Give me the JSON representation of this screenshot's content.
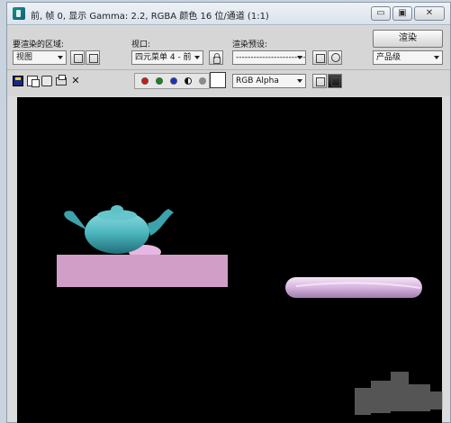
{
  "window": {
    "title": "前, 帧 0, 显示 Gamma: 2.2, RGBA 颜色 16 位/通道 (1:1)",
    "controls": [
      "minimize-icon",
      "maximize-icon",
      "close-icon"
    ]
  },
  "render_area": {
    "label": "要渲染的区域:",
    "value": "视图"
  },
  "viewport_select": {
    "label": "视口:",
    "value": "四元菜单 4 - 前"
  },
  "render_preset": {
    "label": "渲染预设:",
    "value": "-------------------------"
  },
  "render_button": {
    "label": "渲染"
  },
  "quality": {
    "value": "产品级"
  },
  "toolbar": {
    "icons": [
      "save-image-icon",
      "copy-image-icon",
      "clone-window-icon",
      "print-icon",
      "clear-icon"
    ],
    "clear_glyph": "✕"
  },
  "channels": {
    "colors": {
      "red": "#d01818",
      "green": "#0e8a1e",
      "blue": "#1a2fc0",
      "mono": "#111111",
      "gray": "#8a8a8a"
    }
  },
  "display_channel": {
    "value": "RGB Alpha"
  },
  "colors": {
    "teapot": "#4fb7bf",
    "box": "#d09ec6",
    "pill": "#d7b3e0",
    "background": "#000000"
  }
}
